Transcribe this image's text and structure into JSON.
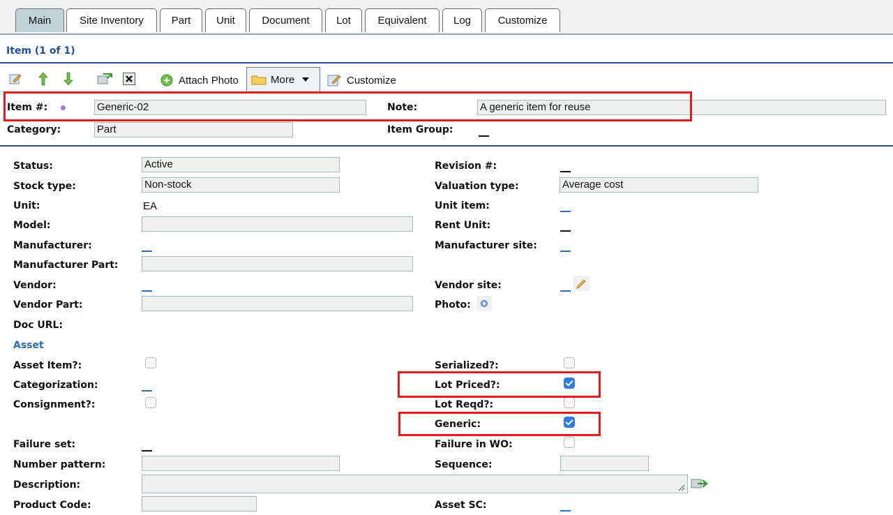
{
  "tabs": [
    {
      "label": "Main",
      "active": true
    },
    {
      "label": "Site Inventory"
    },
    {
      "label": "Part"
    },
    {
      "label": "Unit"
    },
    {
      "label": "Document"
    },
    {
      "label": "Lot"
    },
    {
      "label": "Equivalent"
    },
    {
      "label": "Log"
    },
    {
      "label": "Customize"
    }
  ],
  "title": "Item (1 of 1)",
  "toolbar": {
    "attach_photo": "Attach Photo",
    "more": "More",
    "customize": "Customize"
  },
  "header": {
    "item_num_label": "Item #:",
    "item_num_value": "Generic-02",
    "note_label": "Note:",
    "note_value": "A generic item for reuse",
    "category_label": "Category:",
    "category_value": "Part",
    "item_group_label": "Item Group:"
  },
  "form": {
    "status_label": "Status:",
    "status_value": "Active",
    "stock_type_label": "Stock type:",
    "stock_type_value": "Non-stock",
    "unit_label": "Unit:",
    "unit_value": "EA",
    "model_label": "Model:",
    "manufacturer_label": "Manufacturer:",
    "manufacturer_part_label": "Manufacturer Part:",
    "vendor_label": "Vendor:",
    "vendor_part_label": "Vendor Part:",
    "doc_url_label": "Doc URL:",
    "asset_section": "Asset",
    "asset_item_label": "Asset Item?:",
    "categorization_label": "Categorization:",
    "consignment_label": "Consignment?:",
    "failure_set_label": "Failure set:",
    "number_pattern_label": "Number pattern:",
    "description_label": "Description:",
    "product_code_label": "Product Code:",
    "revision_label": "Revision #:",
    "valuation_type_label": "Valuation type:",
    "valuation_type_value": "Average cost",
    "unit_item_label": "Unit item:",
    "rent_unit_label": "Rent Unit:",
    "manufacturer_site_label": "Manufacturer site:",
    "vendor_site_label": "Vendor site:",
    "photo_label": "Photo:",
    "serialized_label": "Serialized?:",
    "lot_priced_label": "Lot Priced?:",
    "lot_reqd_label": "Lot Reqd?:",
    "generic_label": "Generic:",
    "failure_in_wo_label": "Failure in WO:",
    "sequence_label": "Sequence:",
    "asset_sc_label": "Asset SC:"
  },
  "checks": {
    "asset_item": false,
    "consignment": false,
    "serialized": false,
    "lot_priced": true,
    "lot_reqd": false,
    "generic": true,
    "failure_in_wo": false
  },
  "colors": {
    "highlight": "#e21b1b",
    "active_tab": "#bfd3d8",
    "link_blue": "#2e6ac0"
  }
}
